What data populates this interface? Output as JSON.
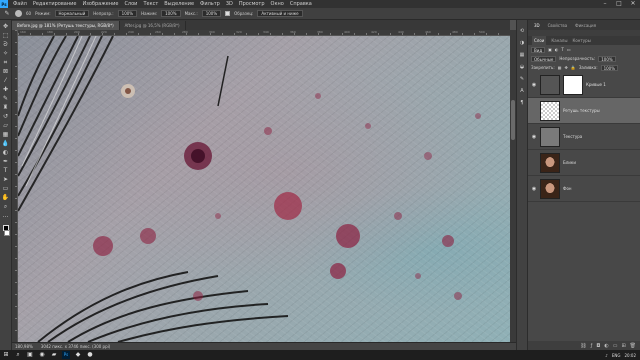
{
  "menubar": {
    "logo": "Ps",
    "items": [
      "Файл",
      "Редактирование",
      "Изображение",
      "Слои",
      "Текст",
      "Выделение",
      "Фильтр",
      "3D",
      "Просмотр",
      "Окно",
      "Справка"
    ]
  },
  "options": {
    "brush_size": "60",
    "mode_label": "Режим:",
    "mode_value": "Нормальный",
    "opacity_label": "Непрозр.:",
    "opacity_value": "100%",
    "pressure_label": "Нажим:",
    "pressure_value": "100%",
    "flow_label": "Макс.:",
    "flow_value": "100%",
    "sample_label": "Образец:",
    "sample_value": "Активный и ниже"
  },
  "tabs": [
    {
      "label": "Before.jpg @ 181% (Ретушь текстуры, RGB/8*)",
      "active": true
    },
    {
      "label": "After.jpg @ 16,5% (RGB/8*)",
      "active": false
    }
  ],
  "ruler_numbers": [
    "160",
    "180",
    "200",
    "220",
    "240",
    "260",
    "280",
    "300",
    "320",
    "340",
    "360",
    "380",
    "400",
    "420",
    "440",
    "460",
    "480",
    "500"
  ],
  "status": {
    "zoom": "180,98%",
    "doc_info": "3042 пикс. x 3746 пикс. (300 ppi)"
  },
  "panel": {
    "top_tabs": [
      "3D",
      "Свойства",
      "Фиксация"
    ],
    "tabs": [
      "Слои",
      "Каналы",
      "Контуры"
    ],
    "kind_label": "Вид",
    "blend_mode": "Обычные",
    "opacity_label": "Непрозрачность:",
    "opacity_value": "100%",
    "lock_label": "Закрепить:",
    "fill_label": "Заливка:",
    "fill_value": "100%",
    "layers": [
      {
        "name": "Кривые 1",
        "thumb": "white",
        "selected": false,
        "visible": true
      },
      {
        "name": "Ретушь текстуры",
        "thumb": "transparent",
        "selected": true,
        "visible": false
      },
      {
        "name": "Текстура",
        "thumb": "gray",
        "selected": false,
        "visible": true
      },
      {
        "name": "Блики",
        "thumb": "face",
        "selected": false,
        "visible": false
      },
      {
        "name": "Фон",
        "thumb": "face",
        "selected": false,
        "visible": true
      }
    ]
  },
  "taskbar": {
    "lang": "ENG",
    "time": "20:02"
  },
  "colors": {
    "accent": "#31a8ff",
    "spot": "#8c2040"
  }
}
